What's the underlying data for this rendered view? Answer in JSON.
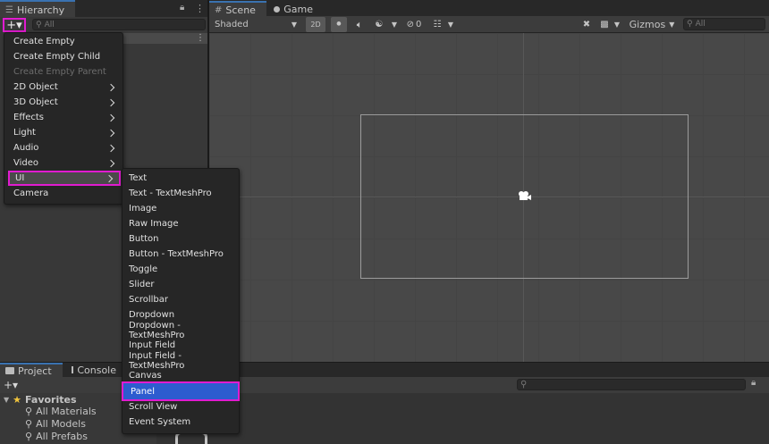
{
  "hierarchy": {
    "tab_label": "Hierarchy",
    "add_label": "+▾",
    "search_placeholder": "All"
  },
  "scene": {
    "tabs": [
      "Scene",
      "Game"
    ],
    "shading": "Shaded",
    "mode_2d": "2D",
    "hidden_count": "0",
    "gizmos": "Gizmos",
    "search_placeholder": "All"
  },
  "bottom": {
    "tabs": [
      "Project",
      "Console"
    ],
    "add_label": "+▾",
    "favorites": {
      "title": "Favorites",
      "items": [
        "All Materials",
        "All Models",
        "All Prefabs"
      ]
    }
  },
  "main_menu": {
    "items": [
      {
        "label": "Create Empty",
        "submenu": false,
        "disabled": false
      },
      {
        "label": "Create Empty Child",
        "submenu": false,
        "disabled": false
      },
      {
        "label": "Create Empty Parent",
        "submenu": false,
        "disabled": true
      },
      {
        "label": "2D Object",
        "submenu": true,
        "disabled": false
      },
      {
        "label": "3D Object",
        "submenu": true,
        "disabled": false
      },
      {
        "label": "Effects",
        "submenu": true,
        "disabled": false
      },
      {
        "label": "Light",
        "submenu": true,
        "disabled": false
      },
      {
        "label": "Audio",
        "submenu": true,
        "disabled": false
      },
      {
        "label": "Video",
        "submenu": true,
        "disabled": false
      },
      {
        "label": "UI",
        "submenu": true,
        "disabled": false
      },
      {
        "label": "Camera",
        "submenu": false,
        "disabled": false
      }
    ]
  },
  "ui_submenu": {
    "items": [
      "Text",
      "Text - TextMeshPro",
      "Image",
      "Raw Image",
      "Button",
      "Button - TextMeshPro",
      "Toggle",
      "Slider",
      "Scrollbar",
      "Dropdown",
      "Dropdown - TextMeshPro",
      "Input Field",
      "Input Field - TextMeshPro",
      "Canvas",
      "Panel",
      "Scroll View",
      "Event System"
    ],
    "selected": "Panel"
  },
  "colors": {
    "highlight_outline": "#e11bd0",
    "selection": "#2d5ccf",
    "active_tab_accent": "#3a72b0"
  }
}
